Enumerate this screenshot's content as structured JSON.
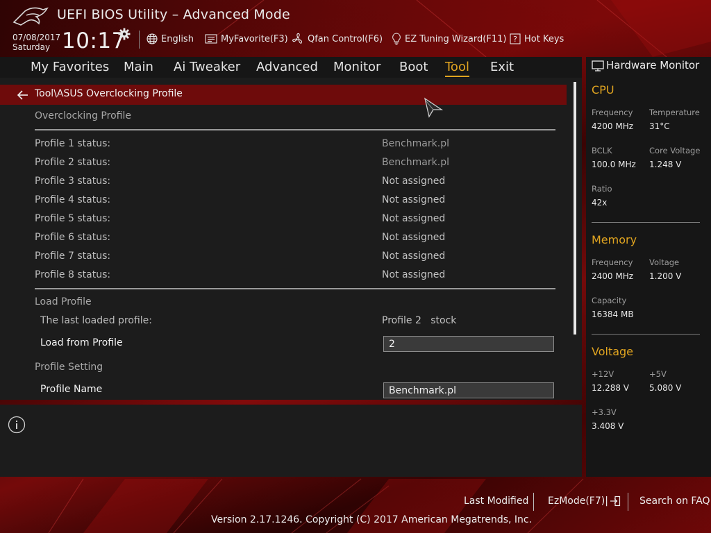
{
  "header": {
    "title": "UEFI BIOS Utility – Advanced Mode",
    "date": "07/08/2017",
    "day": "Saturday",
    "time": "10:17",
    "items": {
      "language": "English",
      "myfavorite": "MyFavorite(F3)",
      "qfan": "Qfan Control(F6)",
      "ez_tuning": "EZ Tuning Wizard(F11)",
      "hotkeys": "Hot Keys"
    }
  },
  "nav": {
    "favorites": "My Favorites",
    "main": "Main",
    "ai_tweaker": "Ai Tweaker",
    "advanced": "Advanced",
    "monitor": "Monitor",
    "boot": "Boot",
    "tool": "Tool",
    "exit": "Exit",
    "active": "Tool"
  },
  "main": {
    "breadcrumb": "Tool\\ASUS Overclocking Profile",
    "section_profiles": "Overclocking Profile",
    "profiles": [
      {
        "label": "Profile 1 status:",
        "value": "Benchmark.pl"
      },
      {
        "label": "Profile 2 status:",
        "value": "Benchmark.pl"
      },
      {
        "label": "Profile 3 status:",
        "value": "Not assigned"
      },
      {
        "label": "Profile 4 status:",
        "value": "Not assigned"
      },
      {
        "label": "Profile 5 status:",
        "value": "Not assigned"
      },
      {
        "label": "Profile 6 status:",
        "value": "Not assigned"
      },
      {
        "label": "Profile 7 status:",
        "value": "Not assigned"
      },
      {
        "label": "Profile 8 status:",
        "value": "Not assigned"
      }
    ],
    "section_load": "Load Profile",
    "last_loaded_label": "The last loaded profile:",
    "last_loaded_value": "Profile 2   stock",
    "load_from_label": "Load from Profile",
    "load_from_value": "2",
    "section_setting": "Profile Setting",
    "profile_name_label": "Profile Name",
    "profile_name_value": "Benchmark.pl"
  },
  "hw": {
    "title": "Hardware Monitor",
    "cpu": {
      "heading": "CPU",
      "freq_label": "Frequency",
      "freq_value": "4200 MHz",
      "temp_label": "Temperature",
      "temp_value": "31°C",
      "bclk_label": "BCLK",
      "bclk_value": "100.0 MHz",
      "corev_label": "Core Voltage",
      "corev_value": "1.248 V",
      "ratio_label": "Ratio",
      "ratio_value": "42x"
    },
    "memory": {
      "heading": "Memory",
      "freq_label": "Frequency",
      "freq_value": "2400 MHz",
      "volt_label": "Voltage",
      "volt_value": "1.200 V",
      "cap_label": "Capacity",
      "cap_value": "16384 MB"
    },
    "voltage": {
      "heading": "Voltage",
      "v12_label": "+12V",
      "v12_value": "12.288 V",
      "v5_label": "+5V",
      "v5_value": "5.080 V",
      "v33_label": "+3.3V",
      "v33_value": "3.408 V"
    }
  },
  "footer": {
    "last_modified": "Last Modified",
    "ezmode": "EzMode(F7)|",
    "search": "Search on FAQ",
    "version": "Version 2.17.1246. Copyright (C) 2017 American Megatrends, Inc."
  },
  "colors": {
    "accent": "#e0a420",
    "breadcrumb_bg": "#6e0b0b",
    "panel_bg": "#1c1c1c"
  }
}
